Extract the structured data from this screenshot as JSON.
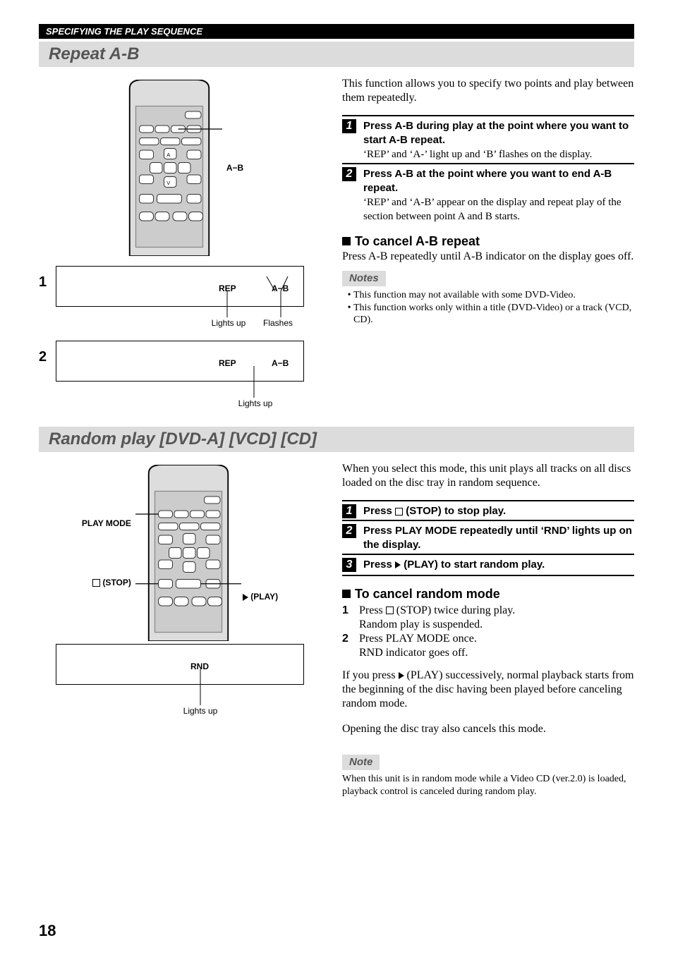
{
  "header": {
    "section_label": "SPECIFYING THE PLAY SEQUENCE"
  },
  "repeat": {
    "title": "Repeat A-B",
    "remote_callout": "A−B",
    "display1": {
      "num": "1",
      "rep": "REP",
      "ab": "A−B",
      "lights": "Lights up",
      "flashes": "Flashes"
    },
    "display2": {
      "num": "2",
      "rep": "REP",
      "ab": "A−B",
      "lights": "Lights up"
    },
    "intro": "This function allows you to specify two points and play between them repeatedly.",
    "step1": {
      "bold": "Press A-B during play at the point where you want to start A-B repeat.",
      "detail": "‘REP’ and ‘A-’ light up and ‘B’ flashes on the display."
    },
    "step2": {
      "bold": "Press A-B at the point where you want to end A-B repeat.",
      "detail": "‘REP’ and ‘A-B’ appear on the display and repeat play of the section between point A and B starts."
    },
    "cancel_head": "To cancel A-B repeat",
    "cancel_body": "Press A-B repeatedly until A-B indicator on the display goes off.",
    "notes_label": "Notes",
    "note1": "This function may not available with some DVD-Video.",
    "note2": "This function works only within a title (DVD-Video) or a track (VCD, CD)."
  },
  "random": {
    "title": "Random play [DVD-A] [VCD] [CD]",
    "remote": {
      "playmode": "PLAY MODE",
      "stop": "(STOP)",
      "play": "(PLAY)"
    },
    "display": {
      "rnd": "RND",
      "lights": "Lights up"
    },
    "intro": "When you select this mode, this unit plays all tracks on all discs loaded on the disc tray in random sequence.",
    "step1": "Press □ (STOP) to stop play.",
    "step2": "Press PLAY MODE repeatedly until ‘RND’ lights up on the display.",
    "step3": "Press ▷ (PLAY) to start random play.",
    "cancel_head": "To cancel random mode",
    "c1a": "Press □ (STOP) twice during play.",
    "c1b": "Random play is suspended.",
    "c2a": "Press PLAY MODE once.",
    "c2b": "RND indicator goes off.",
    "after": "If you press ▷ (PLAY) successively, normal playback starts from the beginning of the disc having been played before canceling random mode.",
    "after2": "Opening the disc tray also cancels this mode.",
    "note_label": "Note",
    "note_body": "When this unit is in random mode while a Video CD (ver.2.0) is loaded, playback control is canceled during random play."
  },
  "page_number": "18"
}
